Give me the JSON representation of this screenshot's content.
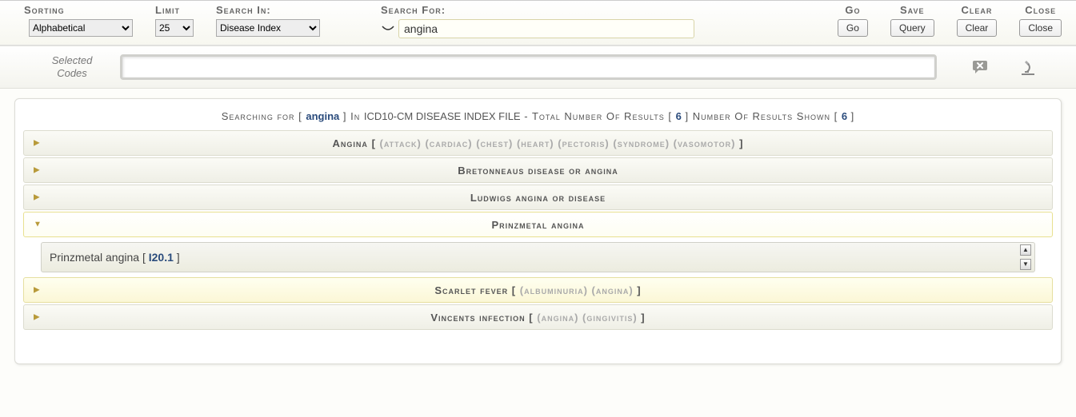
{
  "topbar": {
    "sorting": {
      "label": "Sorting",
      "value": "Alphabetical"
    },
    "limit": {
      "label": "Limit",
      "value": "25"
    },
    "searchIn": {
      "label": "Search In:",
      "value": "Disease Index"
    },
    "searchFor": {
      "label": "Search For:",
      "value": "angina"
    },
    "go": {
      "label": "Go",
      "button": "Go"
    },
    "save": {
      "label": "Save",
      "button": "Query"
    },
    "clear": {
      "label": "Clear",
      "button": "Clear"
    },
    "close": {
      "label": "Close",
      "button": "Close"
    }
  },
  "selectedCodes": {
    "label_line1": "Selected",
    "label_line2": "Codes",
    "value": ""
  },
  "summary": {
    "prefix": "Searching for [",
    "term": "angina",
    "mid1": "] In ",
    "file": "ICD10-CM DISEASE INDEX FILE",
    "mid2": " - Total Number Of Results [",
    "total": "6",
    "mid3": "] Number Of Results Shown [",
    "shown": "6",
    "suffix": "]"
  },
  "rows": {
    "r0": {
      "title": "Angina",
      "qual": "(attack) (cardiac) (chest) (heart) (pectoris) (syndrome) (vasomotor)",
      "has_qual": true
    },
    "r1": {
      "title": "Bretonneaus disease or angina"
    },
    "r2": {
      "title": "Ludwigs angina or disease"
    },
    "r3": {
      "title": "Prinzmetal angina",
      "detail_label": "Prinzmetal angina",
      "detail_code": "I20.1"
    },
    "r4": {
      "title": "Scarlet fever",
      "qual": "(albuminuria) (angina)",
      "has_qual": true
    },
    "r5": {
      "title": "Vincents infection",
      "qual": "(angina) (gingivitis)",
      "has_qual": true
    }
  }
}
